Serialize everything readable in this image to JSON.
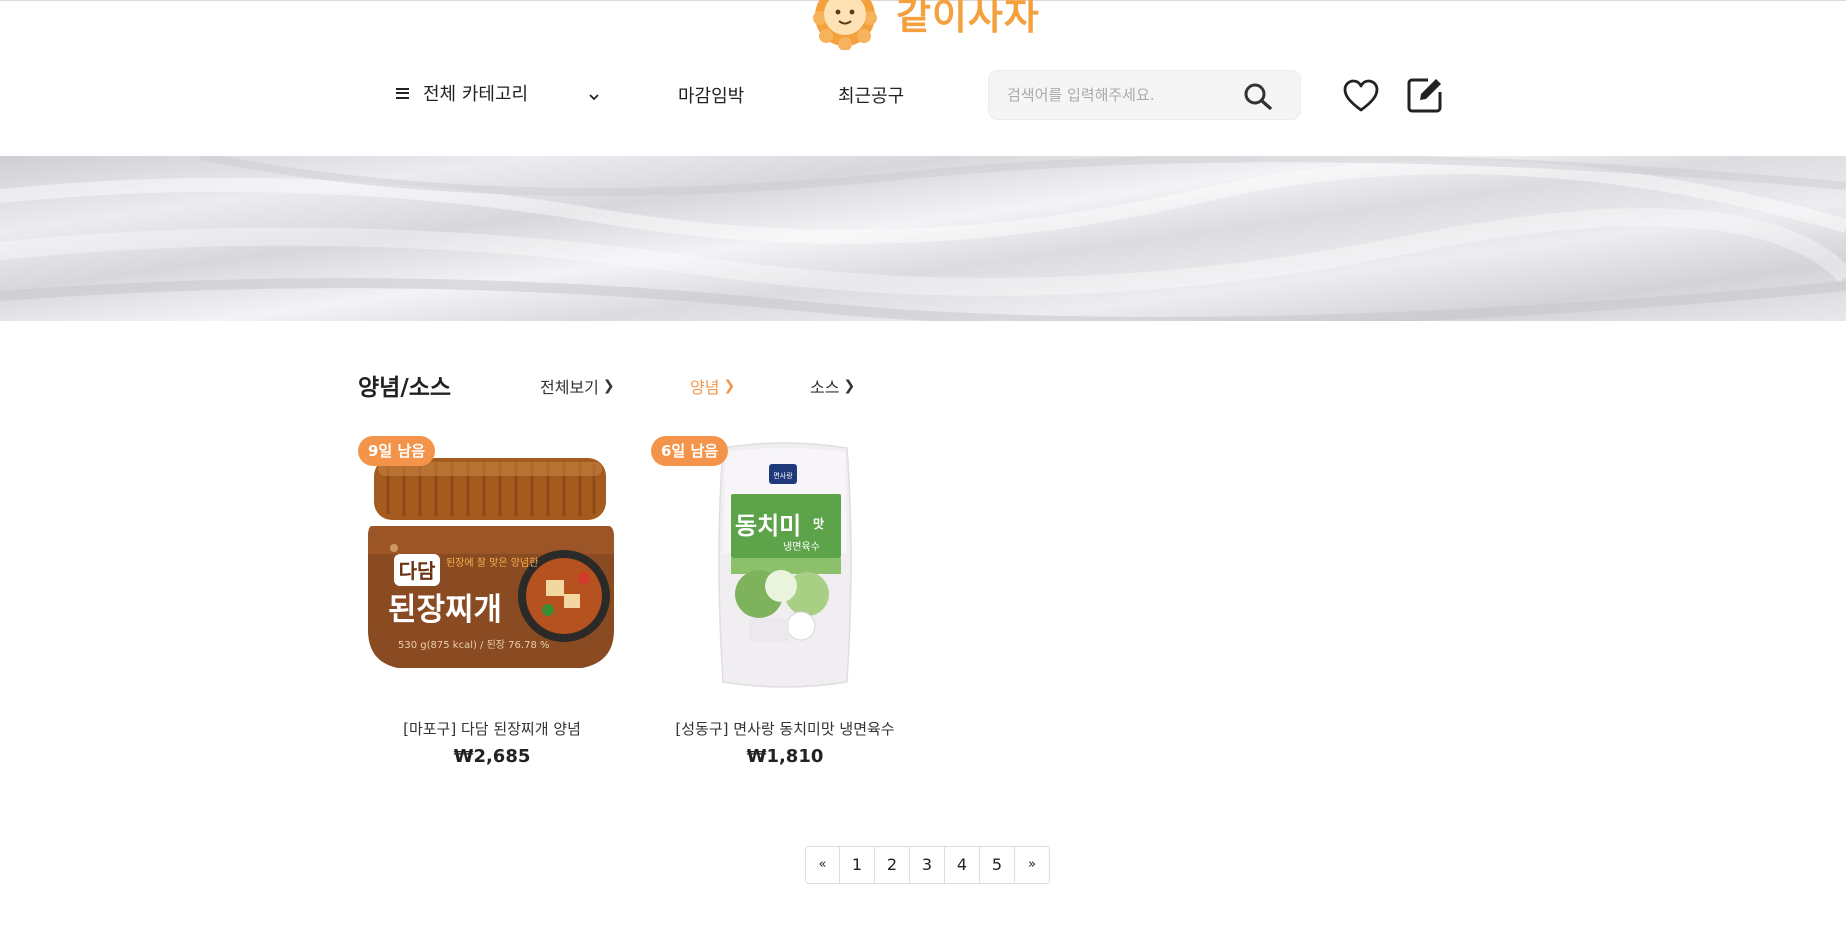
{
  "brand": {
    "name": "같이사자",
    "accent": "#f4a03c",
    "icon": "lion-face-icon"
  },
  "nav": {
    "category_label": "전체 카테고리",
    "links": [
      "마감임박",
      "최근공구"
    ]
  },
  "search": {
    "placeholder": "검색어를 입력해주세요.",
    "value": ""
  },
  "icons": {
    "search": "search-icon",
    "wishlist": "heart-icon",
    "write": "edit-icon",
    "menu": "hamburger-icon",
    "dropdown": "chevron-down-icon"
  },
  "section": {
    "title": "양념/소스",
    "subcategories": [
      {
        "label": "전체보기",
        "active": false
      },
      {
        "label": "양념",
        "active": true
      },
      {
        "label": "소스",
        "active": false
      }
    ],
    "active_color": "#f4944a"
  },
  "products": [
    {
      "badge": "9일 남음",
      "name": "[마포구] 다담 된장찌개 양념",
      "price": "₩2,685"
    },
    {
      "badge": "6일 남음",
      "name": "[성동구] 면사랑 동치미맛 냉면육수",
      "price": "₩1,810"
    }
  ],
  "product_images": {
    "p1": {
      "brand": "다담",
      "title": "된장찌개",
      "tagline": "된장에\n잘 맞은 양념한",
      "net": "530 g(875 kcal) / 된장 76.78 %"
    },
    "p2": {
      "brand": "면사랑",
      "title": "동치미",
      "title_suffix": "맛",
      "subtitle": "냉면육수"
    }
  },
  "pagination": {
    "prev": "«",
    "pages": [
      "1",
      "2",
      "3",
      "4",
      "5"
    ],
    "next": "»"
  }
}
